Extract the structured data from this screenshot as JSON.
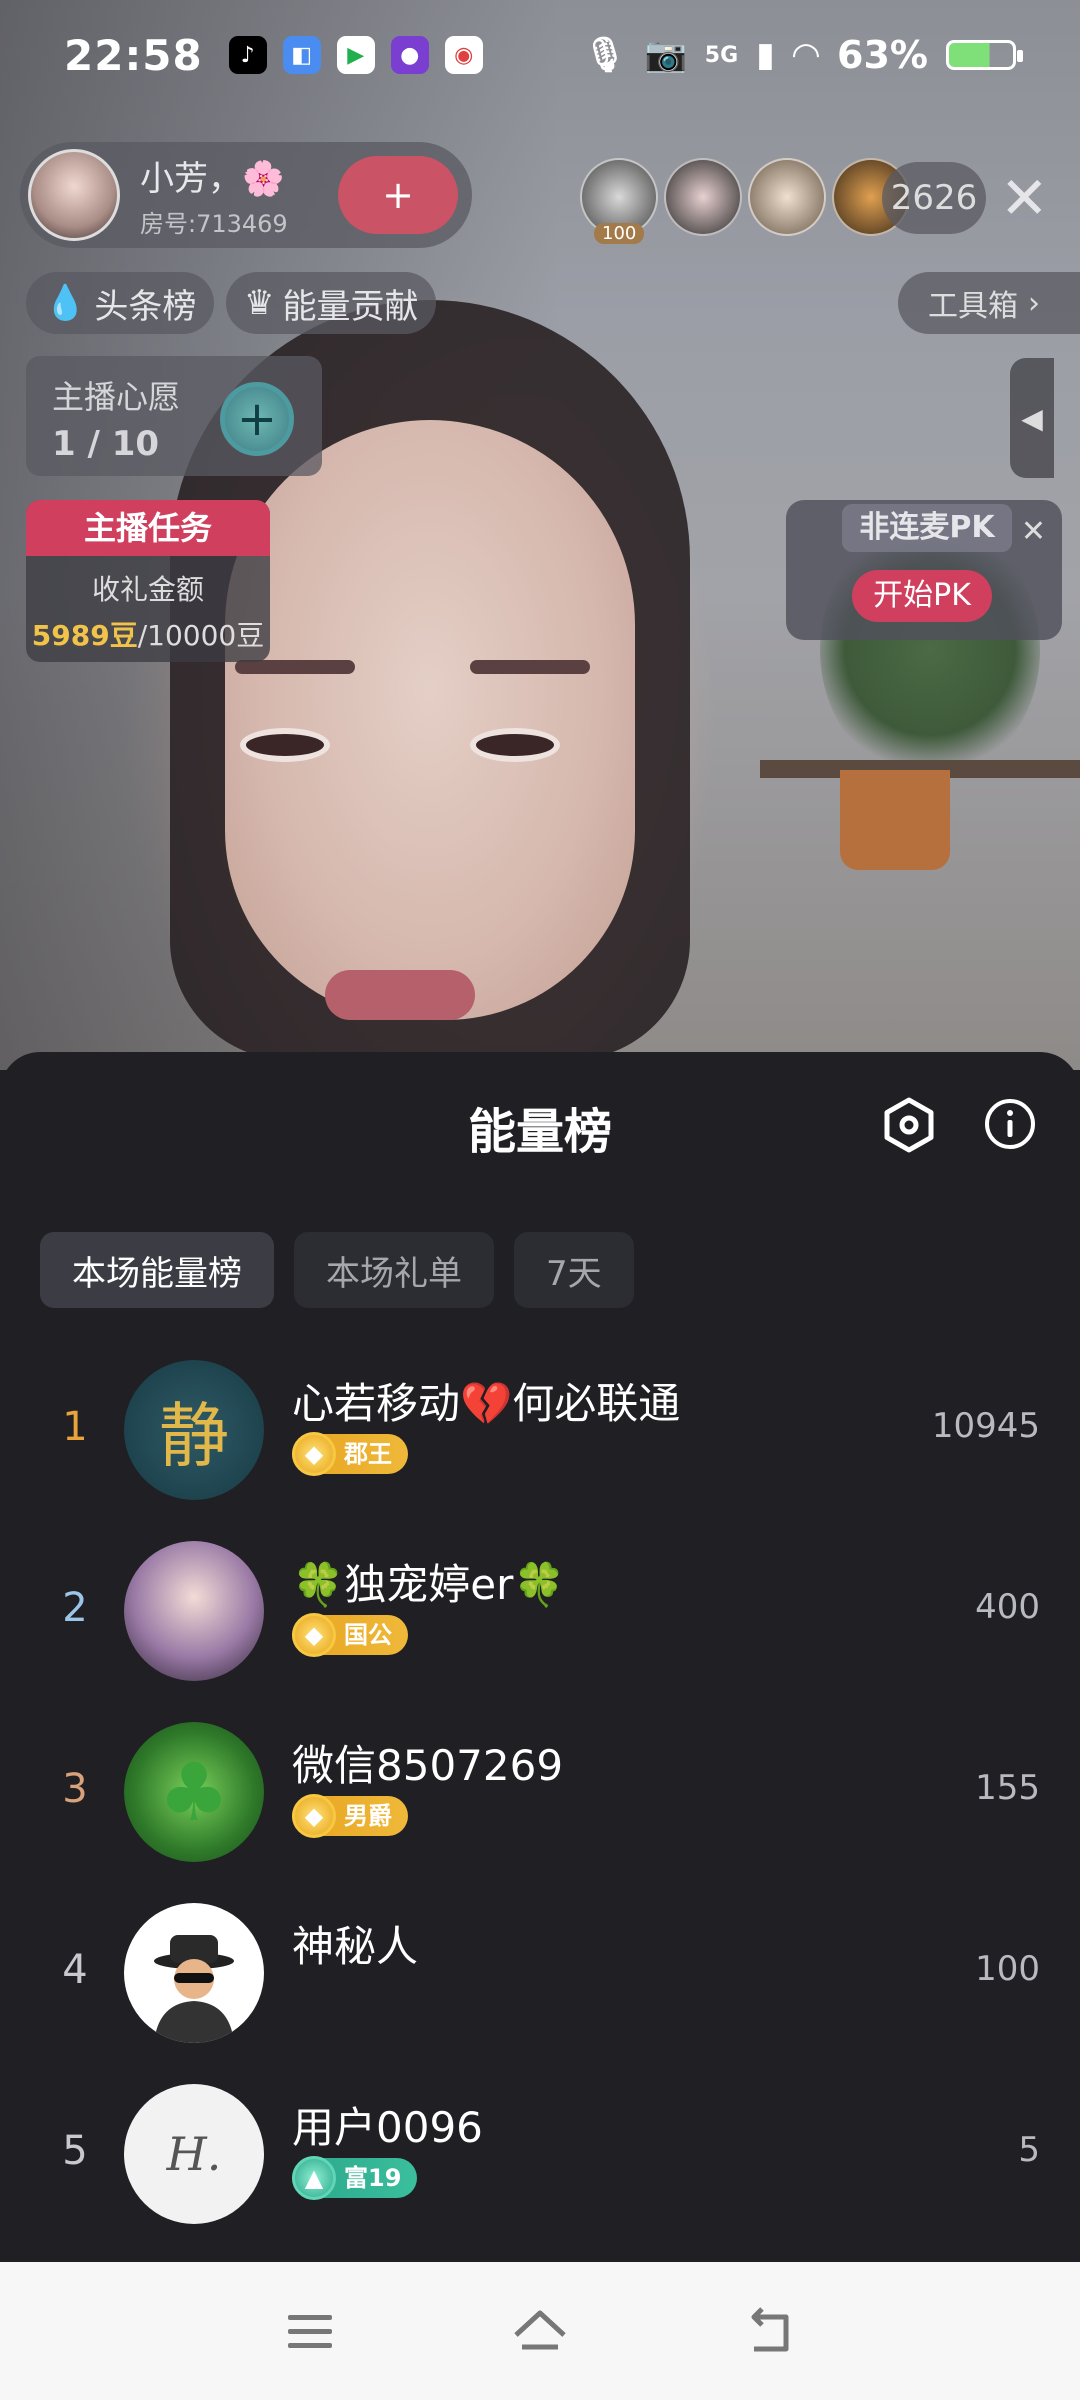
{
  "status_bar": {
    "time": "22:58",
    "network": "5G",
    "battery": "63%",
    "battery_level": 0.63,
    "notification_icons": [
      "tiktok-icon",
      "browser-icon",
      "video-app-icon",
      "live-app-icon",
      "map-app-icon"
    ]
  },
  "host": {
    "name": "小芳，🌸",
    "room": "房号:713469",
    "follow_symbol": "+"
  },
  "viewers": {
    "first_badge": "100",
    "count": "2626",
    "close_symbol": "✕"
  },
  "chips": {
    "headline": "头条榜",
    "energy": "能量贡献",
    "toolbox": "工具箱",
    "toolbox_arrow": "›"
  },
  "wish": {
    "title": "主播心愿",
    "progress": "1 / 10",
    "add_symbol": "+"
  },
  "task": {
    "title": "主播任务",
    "label": "收礼金额",
    "current": "5989豆",
    "target": "/10000豆"
  },
  "pk": {
    "tag": "非连麦PK",
    "close": "✕",
    "start": "开始PK"
  },
  "sheet": {
    "title": "能量榜",
    "tabs": [
      "本场能量榜",
      "本场礼单",
      "7天"
    ],
    "active_tab": 0
  },
  "leaderboard": [
    {
      "rank": "1",
      "name": "心若移动💔何必联通",
      "badge": "郡王",
      "badge_type": "gold",
      "score": "10945",
      "rank_color": "#e8a33a"
    },
    {
      "rank": "2",
      "name": "🍀独宠婷er🍀",
      "badge": "国公",
      "badge_type": "gold",
      "score": "400",
      "rank_color": "#9cc6e8"
    },
    {
      "rank": "3",
      "name": "微信8507269",
      "badge": "男爵",
      "badge_type": "gold",
      "score": "155",
      "rank_color": "#d9a27a"
    },
    {
      "rank": "4",
      "name": "神秘人",
      "badge": "",
      "badge_type": "none",
      "score": "100",
      "rank_color": "#c8c8ce"
    },
    {
      "rank": "5",
      "name": "用户0096",
      "badge": "富19",
      "badge_type": "teal",
      "score": "5",
      "rank_color": "#c8c8ce"
    }
  ],
  "colors": {
    "accent_pink": "#d0405e",
    "sheet_bg": "#1f1f24",
    "gold_badge": "#e6a41f",
    "teal_badge": "#2aa68a"
  }
}
